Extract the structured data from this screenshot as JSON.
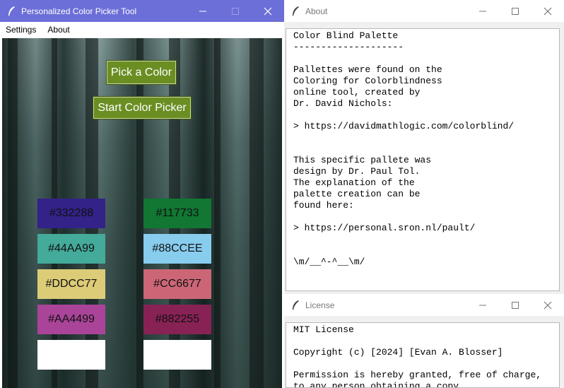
{
  "main": {
    "title": "Personalized Color Picker Tool",
    "menu": [
      "Settings",
      "About"
    ],
    "pick_label": "Pick a Color",
    "start_label": "Start Color Picker",
    "swatches_left": [
      {
        "label": "#332288",
        "color": "#332288"
      },
      {
        "label": "#44AA99",
        "color": "#44AA99"
      },
      {
        "label": "#DDCC77",
        "color": "#DDCC77"
      },
      {
        "label": "#AA4499",
        "color": "#AA4499"
      },
      {
        "label": "",
        "color": "#FFFFFF"
      }
    ],
    "swatches_right": [
      {
        "label": "#117733",
        "color": "#117733"
      },
      {
        "label": "#88CCEE",
        "color": "#88CCEE"
      },
      {
        "label": "#CC6677",
        "color": "#CC6677"
      },
      {
        "label": "#882255",
        "color": "#882255"
      },
      {
        "label": "",
        "color": "#FFFFFF"
      }
    ]
  },
  "about": {
    "title": "About",
    "text": "Color Blind Palette\n--------------------\n\nPallettes were found on the\nColoring for Colorblindness\nonline tool, created by\nDr. David Nichols:\n\n> https://davidmathlogic.com/colorblind/\n\n\nThis specific pallete was\ndesign by Dr. Paul Tol.\nThe explanation of the\npalette creation can be\nfound here:\n\n> https://personal.sron.nl/pault/\n\n\n\\m/__^-^__\\m/"
  },
  "license": {
    "title": "License",
    "text": "MIT License\n\nCopyright (c) [2024] [Evan A. Blosser]\n\nPermission is hereby granted, free of charge,\nto any person obtaining a copy"
  }
}
